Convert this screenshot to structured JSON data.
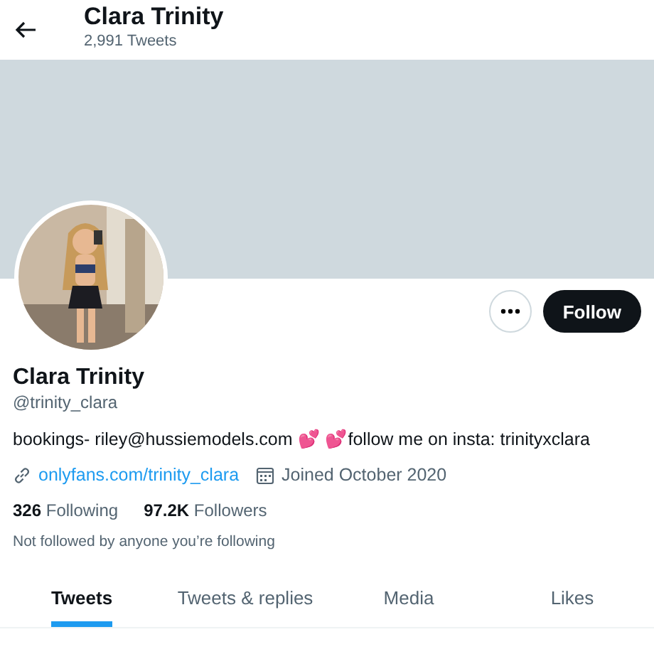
{
  "header": {
    "title": "Clara Trinity",
    "subtitle": "2,991 Tweets"
  },
  "actions": {
    "follow_label": "Follow"
  },
  "profile": {
    "name": "Clara Trinity",
    "handle": "@trinity_clara",
    "bio": "bookings- riley@hussiemodels.com 💕 💕follow me on insta: trinityxclara",
    "link": "onlyfans.com/trinity_clara",
    "joined": "Joined October 2020"
  },
  "stats": [
    "**326** Following",
    "**97.2K** Followers"
  ],
  "followed_by": "Not followed by anyone you’re following",
  "tabs": [
    {
      "label": "Tweets",
      "selected": true
    },
    {
      "label": "Tweets & replies",
      "selected": false
    },
    {
      "label": "Media",
      "selected": false
    },
    {
      "label": "Likes",
      "selected": false
    }
  ]
}
